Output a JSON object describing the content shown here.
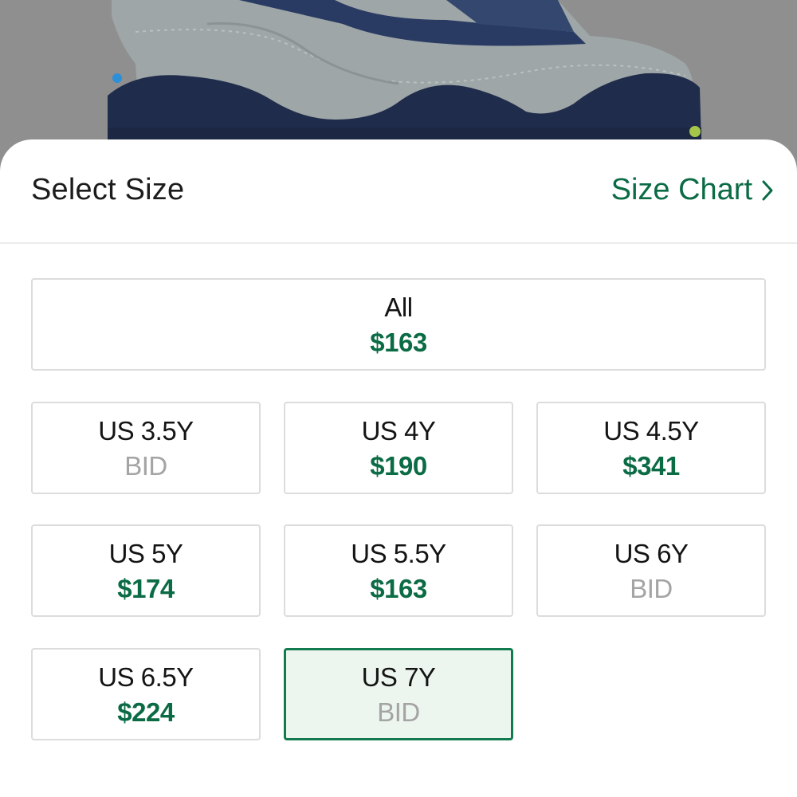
{
  "sheet": {
    "title": "Select Size",
    "size_chart_label": "Size Chart"
  },
  "colors": {
    "accent_green": "#0b6b45",
    "selected_border": "#117a4e",
    "selected_fill": "#ecf6ef",
    "bid_gray": "#a4a4a4",
    "tile_border": "#dcdcdc",
    "shoe_upper": "#9aa2a3",
    "shoe_sole": "#1e2b4a"
  },
  "icons": {
    "size_chart": "chevron-right-icon"
  },
  "sizes": {
    "all": {
      "label": "All",
      "price": "$163",
      "kind": "ask"
    },
    "tiles": [
      {
        "label": "US 3.5Y",
        "price": "BID",
        "kind": "bid",
        "selected": false
      },
      {
        "label": "US 4Y",
        "price": "$190",
        "kind": "ask",
        "selected": false
      },
      {
        "label": "US 4.5Y",
        "price": "$341",
        "kind": "ask",
        "selected": false
      },
      {
        "label": "US 5Y",
        "price": "$174",
        "kind": "ask",
        "selected": false
      },
      {
        "label": "US 5.5Y",
        "price": "$163",
        "kind": "ask",
        "selected": false
      },
      {
        "label": "US 6Y",
        "price": "BID",
        "kind": "bid",
        "selected": false
      },
      {
        "label": "US 6.5Y",
        "price": "$224",
        "kind": "ask",
        "selected": false
      },
      {
        "label": "US 7Y",
        "price": "BID",
        "kind": "bid",
        "selected": true
      }
    ]
  }
}
